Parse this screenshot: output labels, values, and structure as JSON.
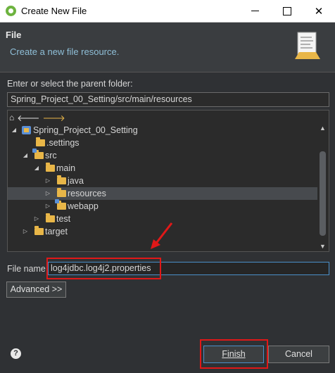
{
  "window": {
    "title": "Create New File"
  },
  "header": {
    "title": "File",
    "description": "Create a new file resource."
  },
  "parent_folder": {
    "label": "Enter or select the parent folder:",
    "value": "Spring_Project_00_Setting/src/main/resources"
  },
  "tree": {
    "items": [
      {
        "label": "Spring_Project_00_Setting",
        "icon": "project-icon",
        "expanded": true
      },
      {
        "label": ".settings",
        "icon": "folder-icon"
      },
      {
        "label": "src",
        "icon": "source-folder-icon",
        "expanded": true
      },
      {
        "label": "main",
        "icon": "folder-icon",
        "expanded": true
      },
      {
        "label": "java",
        "icon": "folder-icon"
      },
      {
        "label": "resources",
        "icon": "folder-icon",
        "selected": true
      },
      {
        "label": "webapp",
        "icon": "source-folder-icon"
      },
      {
        "label": "test",
        "icon": "folder-icon"
      },
      {
        "label": "target",
        "icon": "folder-icon"
      }
    ]
  },
  "file_name": {
    "label": "File name:",
    "value": "log4jdbc.log4j2.properties"
  },
  "advanced": {
    "label": "Advanced >>"
  },
  "footer": {
    "help_icon": "?",
    "finish_label": "Finish",
    "cancel_label": "Cancel"
  },
  "colors": {
    "highlight": "#e01818",
    "header_text": "#8fbfd8"
  }
}
